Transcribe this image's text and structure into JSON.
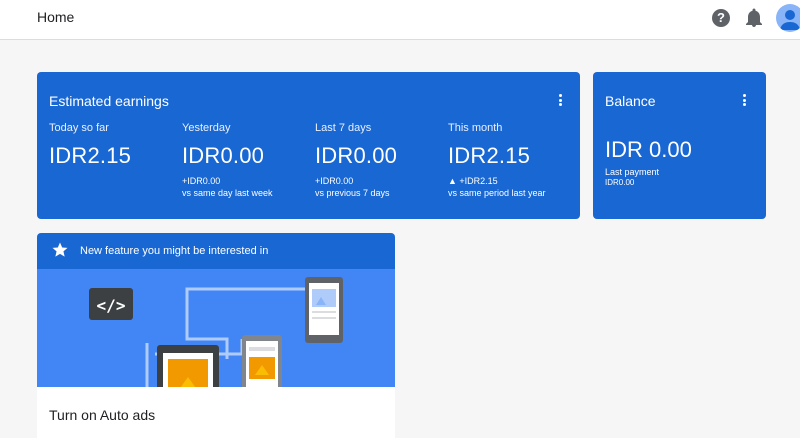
{
  "header": {
    "title": "Home",
    "help_icon": "help-circle-icon",
    "bell_icon": "bell-icon",
    "avatar_icon": "account-avatar-icon"
  },
  "earnings": {
    "title": "Estimated earnings",
    "metrics": [
      {
        "label": "Today so far",
        "value": "IDR2.15",
        "delta": "",
        "comparison": ""
      },
      {
        "label": "Yesterday",
        "value": "IDR0.00",
        "delta": "+IDR0.00",
        "comparison": "vs same day last week"
      },
      {
        "label": "Last 7 days",
        "value": "IDR0.00",
        "delta": "+IDR0.00",
        "comparison": "vs previous 7 days"
      },
      {
        "label": "This month",
        "value": "IDR2.15",
        "delta": "▲ +IDR2.15",
        "comparison": "vs same period last year"
      }
    ]
  },
  "balance": {
    "title": "Balance",
    "value": "IDR 0.00",
    "last_payment_label": "Last payment",
    "last_payment_value": "IDR0.00"
  },
  "feature": {
    "header_text": "New feature you might be interested in",
    "cta_title": "Turn on Auto ads",
    "code_glyph": "</>"
  },
  "colors": {
    "card_blue": "#1967d2",
    "illustration_blue": "#4285f4",
    "accent_orange": "#f29900"
  }
}
